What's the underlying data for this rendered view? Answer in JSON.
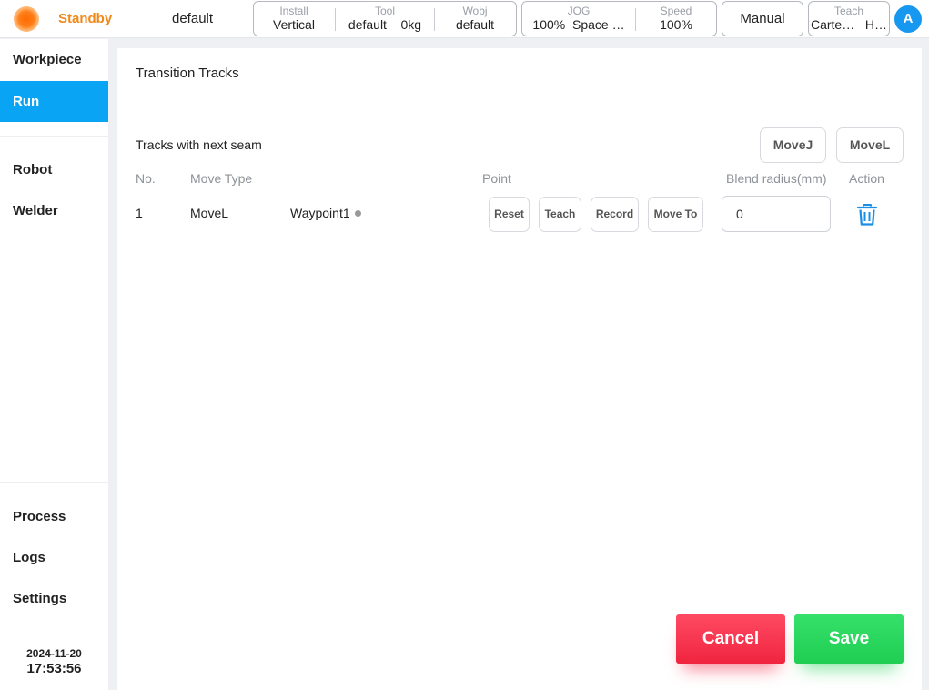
{
  "topbar": {
    "status": "Standby",
    "profile": "default",
    "install": {
      "caption": "Install",
      "value": "Vertical"
    },
    "tool": {
      "caption": "Tool",
      "value": "default",
      "load": "0kg"
    },
    "wobj": {
      "caption": "Wobj",
      "value": "default"
    },
    "jog": {
      "caption": "JOG",
      "value": "100%",
      "mode": "Space …"
    },
    "speed": {
      "caption": "Speed",
      "value": "100%"
    },
    "mode_button": "Manual",
    "teach": {
      "caption": "Teach",
      "value": "Carte…",
      "value2": "H…"
    },
    "avatar": "A",
    "status_color": "#f0881a",
    "accent_color": "#1697f0"
  },
  "sidebar": {
    "items": [
      {
        "label": "Workpiece"
      },
      {
        "label": "Run"
      },
      {
        "label": "Robot"
      },
      {
        "label": "Welder"
      },
      {
        "label": "Process"
      },
      {
        "label": "Logs"
      },
      {
        "label": "Settings"
      }
    ],
    "active_item": "Run",
    "date": "2024-11-20",
    "time": "17:53:56"
  },
  "panel": {
    "title": "Transition Tracks",
    "section_title": "Tracks with next seam",
    "movej_button": "MoveJ",
    "movel_button": "MoveL",
    "columns": [
      "No.",
      "Move Type",
      "Point",
      "Blend radius(mm)",
      "Action"
    ],
    "rows": [
      {
        "no": "1",
        "move_type": "MoveL",
        "point": "Waypoint1",
        "reset": "Reset",
        "teach": "Teach",
        "record": "Record",
        "move_to": "Move To",
        "blend_radius": "0",
        "action_icon": "trash-icon"
      }
    ],
    "cancel_button": "Cancel",
    "save_button": "Save",
    "cancel_color": "#f0243f",
    "save_color": "#1fce52"
  }
}
